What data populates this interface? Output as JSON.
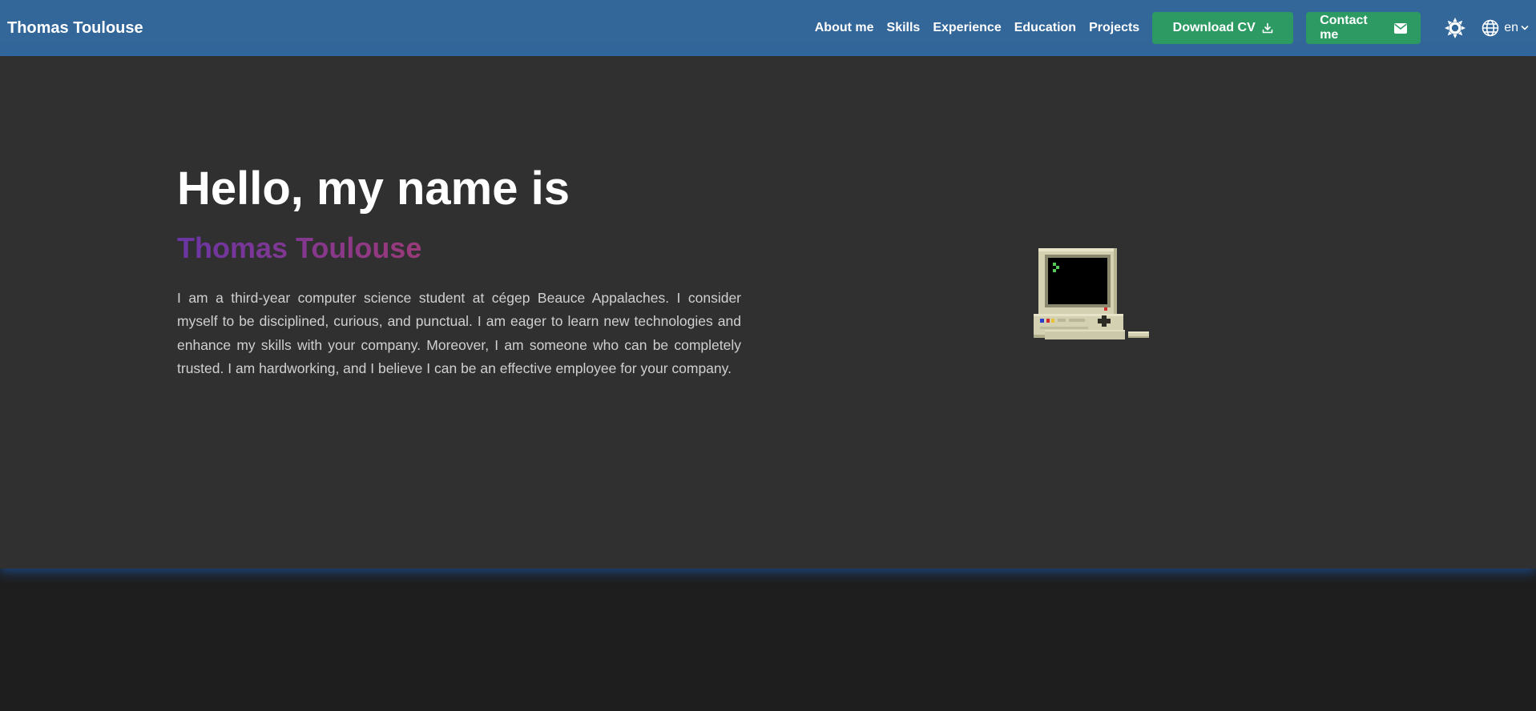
{
  "navbar": {
    "brand": "Thomas Toulouse",
    "links": [
      "About me",
      "Skills",
      "Experience",
      "Education",
      "Projects"
    ],
    "download_cv": "Download CV",
    "contact_me": "Contact me",
    "language": "en",
    "icons": {
      "download": "download-icon",
      "contact": "envelope-icon",
      "theme": "sun-icon",
      "language": "globe-icon",
      "caret": "chevron-down-icon"
    },
    "colors": {
      "background": "#336699",
      "button": "#2e9a63"
    }
  },
  "hero": {
    "title": "Hello, my name is",
    "name": "Thomas Toulouse",
    "description": "I am a third-year computer science student at cégep Beauce Appalaches. I consider myself to be disciplined, curious, and punctual. I am eager to learn new technologies and enhance my skills with your company. Moreover, I am someone who can be completely trusted. I am hardworking, and I believe I can be an effective employee for your company.",
    "illustration": "retro-computer-icon",
    "colors": {
      "background": "#303030",
      "name_gradient_start": "#6b35a5",
      "name_gradient_end": "#9b3a7a"
    }
  }
}
